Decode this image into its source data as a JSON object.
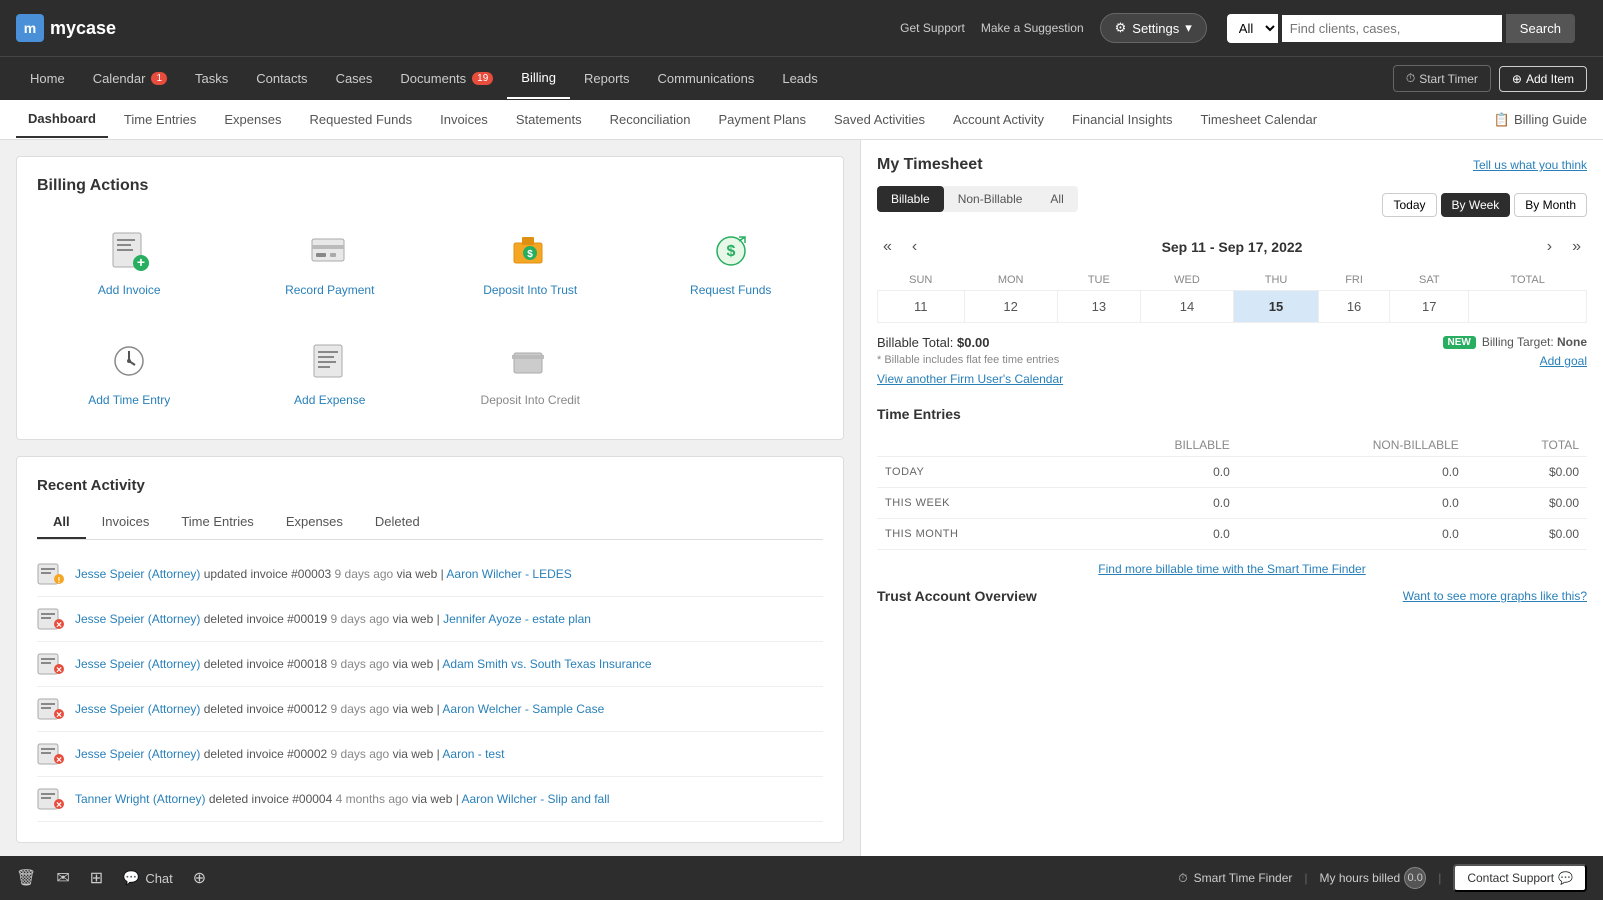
{
  "app": {
    "name": "mycase",
    "logo_text": "m"
  },
  "topLinks": {
    "support": "Get Support",
    "suggestion": "Make a Suggestion"
  },
  "settings": {
    "label": "Settings"
  },
  "search": {
    "placeholder": "Find clients, cases, and items...",
    "button": "Search",
    "filter": "All"
  },
  "mainNav": {
    "items": [
      {
        "label": "Home",
        "active": false,
        "badge": null
      },
      {
        "label": "Calendar",
        "active": false,
        "badge": "1"
      },
      {
        "label": "Tasks",
        "active": false,
        "badge": null
      },
      {
        "label": "Contacts",
        "active": false,
        "badge": null
      },
      {
        "label": "Cases",
        "active": false,
        "badge": null
      },
      {
        "label": "Documents",
        "active": false,
        "badge": "19"
      },
      {
        "label": "Billing",
        "active": true,
        "badge": null
      },
      {
        "label": "Reports",
        "active": false,
        "badge": null
      },
      {
        "label": "Communications",
        "active": false,
        "badge": null
      },
      {
        "label": "Leads",
        "active": false,
        "badge": null
      }
    ],
    "startTimer": "Start Timer",
    "addItem": "Add Item"
  },
  "subNav": {
    "items": [
      {
        "label": "Dashboard",
        "active": true
      },
      {
        "label": "Time Entries",
        "active": false
      },
      {
        "label": "Expenses",
        "active": false
      },
      {
        "label": "Requested Funds",
        "active": false
      },
      {
        "label": "Invoices",
        "active": false
      },
      {
        "label": "Statements",
        "active": false
      },
      {
        "label": "Reconciliation",
        "active": false
      },
      {
        "label": "Payment Plans",
        "active": false
      },
      {
        "label": "Saved Activities",
        "active": false
      },
      {
        "label": "Account Activity",
        "active": false
      },
      {
        "label": "Financial Insights",
        "active": false
      },
      {
        "label": "Timesheet Calendar",
        "active": false
      }
    ],
    "billingGuide": "Billing Guide"
  },
  "billingActions": {
    "title": "Billing Actions",
    "actions": [
      {
        "label": "Add Invoice",
        "id": "add-invoice"
      },
      {
        "label": "Record Payment",
        "id": "record-payment"
      },
      {
        "label": "Deposit Into Trust",
        "id": "deposit-trust"
      },
      {
        "label": "Request Funds",
        "id": "request-funds"
      },
      {
        "label": "Add Time Entry",
        "id": "add-time-entry"
      },
      {
        "label": "Add Expense",
        "id": "add-expense"
      },
      {
        "label": "Deposit Into Credit",
        "id": "deposit-credit"
      }
    ]
  },
  "recentActivity": {
    "title": "Recent Activity",
    "tabs": [
      "All",
      "Invoices",
      "Time Entries",
      "Expenses",
      "Deleted"
    ],
    "activeTab": "All",
    "rows": [
      {
        "user": "Jesse Speier (Attorney)",
        "action": "updated invoice #00003",
        "time": "9 days ago",
        "via": "via web",
        "link": "Aaron Wilcher - LEDES",
        "type": "updated"
      },
      {
        "user": "Jesse Speier (Attorney)",
        "action": "deleted invoice #00019",
        "time": "9 days ago",
        "via": "via web",
        "link": "Jennifer Ayoze - estate plan",
        "type": "deleted"
      },
      {
        "user": "Jesse Speier (Attorney)",
        "action": "deleted invoice #00018",
        "time": "9 days ago",
        "via": "via web",
        "link": "Adam Smith vs. South Texas Insurance",
        "type": "deleted"
      },
      {
        "user": "Jesse Speier (Attorney)",
        "action": "deleted invoice #00012",
        "time": "9 days ago",
        "via": "via web",
        "link": "Aaron Welcher - Sample Case",
        "type": "deleted"
      },
      {
        "user": "Jesse Speier (Attorney)",
        "action": "deleted invoice #00002",
        "time": "9 days ago",
        "via": "via web",
        "link": "Aaron - test",
        "type": "deleted"
      },
      {
        "user": "Tanner Wright (Attorney)",
        "action": "deleted invoice #00004",
        "time": "4 months ago",
        "via": "via web",
        "link": "Aaron Wilcher - Slip and fall",
        "type": "deleted"
      }
    ]
  },
  "timesheet": {
    "title": "My Timesheet",
    "tellUs": "Tell us what you think",
    "toggles": [
      "Billable",
      "Non-Billable",
      "All"
    ],
    "activeToggle": "Billable",
    "dateRange": "Sep 11 - Sep 17, 2022",
    "calControls": [
      "Today",
      "By Week",
      "By Month"
    ],
    "activeCalControl": "By Week",
    "days": [
      "SUN",
      "MON",
      "TUE",
      "WED",
      "THU",
      "FRI",
      "SAT",
      "TOTAL"
    ],
    "dates": [
      "11",
      "12",
      "13",
      "14",
      "15",
      "16",
      "17",
      ""
    ],
    "todayIndex": 4,
    "billableTotal": "$0.00",
    "billableLabel": "Billable Total:",
    "billableNote": "* Billable includes flat fee time entries",
    "viewCalendar": "View another Firm User's Calendar",
    "billingTargetNew": "NEW",
    "billingTargetLabel": "Billing Target:",
    "billingTargetValue": "None",
    "addGoal": "Add goal",
    "timeEntriesTitle": "Time Entries",
    "teColumns": [
      "",
      "BILLABLE",
      "NON-BILLABLE",
      "TOTAL"
    ],
    "teRows": [
      {
        "label": "TODAY",
        "billable": "0.0",
        "nonBillable": "0.0",
        "total": "$0.00"
      },
      {
        "label": "THIS WEEK",
        "billable": "0.0",
        "nonBillable": "0.0",
        "total": "$0.00"
      },
      {
        "label": "THIS MONTH",
        "billable": "0.0",
        "nonBillable": "0.0",
        "total": "$0.00"
      }
    ],
    "smartTimeFinder": "Find more billable time with the Smart Time Finder"
  },
  "trustOverview": {
    "title": "Trust Account Overview",
    "wantGraphs": "Want to see more graphs like this?"
  },
  "bottomBar": {
    "chat": "Chat",
    "smartTimeFinder": "Smart Time Finder",
    "myHoursBilled": "My hours billed",
    "hoursValue": "0.0",
    "contactSupport": "Contact Support"
  }
}
